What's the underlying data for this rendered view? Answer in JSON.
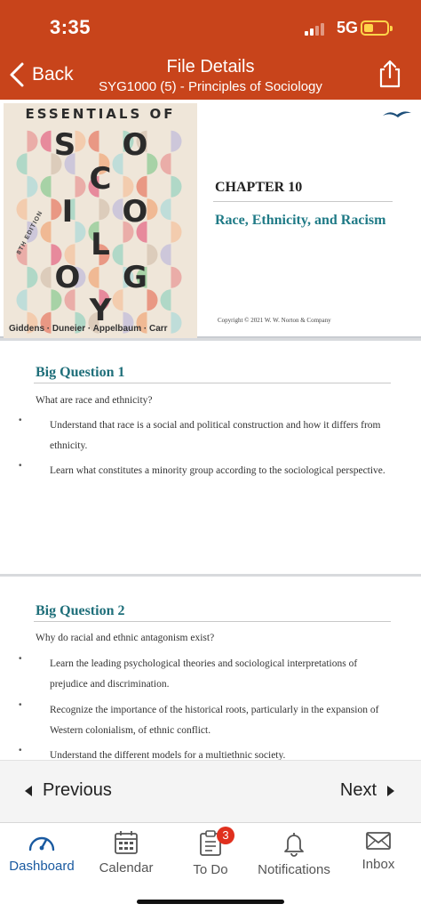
{
  "status": {
    "time": "3:35",
    "network": "5G",
    "battery_color": "#ffd54a"
  },
  "header": {
    "back_label": "Back",
    "title": "File Details",
    "subtitle": "SYG1000 (5) - Principles of Sociology",
    "background": "#c8441b",
    "share_icon": "share-icon"
  },
  "document": {
    "cover": {
      "title": "ESSENTIALS OF",
      "letters": [
        "S",
        "O",
        "C",
        "I",
        "O",
        "L",
        "O",
        "G",
        "Y"
      ],
      "edition": "8TH EDITION",
      "authors": "Giddens · Duneier · Appelbaum · Carr"
    },
    "chapter": "CHAPTER 10",
    "chapter_title": "Race, Ethnicity, and Racism",
    "copyright": "Copyright © 2021 W. W. Norton & Company",
    "big_questions": [
      {
        "title": "Big Question 1",
        "question": "What are race and ethnicity?",
        "bullets": [
          "Understand that race is a social and political construction and how it differs from ethnicity.",
          "Learn what constitutes a minority group according to the sociological perspective."
        ]
      },
      {
        "title": "Big Question 2",
        "question": "Why do racial and ethnic antagonism exist?",
        "bullets": [
          "Learn the leading psychological theories and sociological interpretations of prejudice and discrimination.",
          "Recognize the importance of the historical roots, particularly in the expansion of Western colonialism, of ethnic conflict.",
          "Understand the different models for a multiethnic society."
        ]
      }
    ]
  },
  "pager": {
    "previous_label": "Previous",
    "next_label": "Next"
  },
  "tabs": [
    {
      "label": "Dashboard",
      "icon": "dashboard-icon",
      "active": true
    },
    {
      "label": "Calendar",
      "icon": "calendar-icon",
      "active": false
    },
    {
      "label": "To Do",
      "icon": "todo-icon",
      "active": false,
      "badge": "3"
    },
    {
      "label": "Notifications",
      "icon": "bell-icon",
      "active": false
    },
    {
      "label": "Inbox",
      "icon": "inbox-icon",
      "active": false
    }
  ],
  "colors": {
    "accent": "#1a5aa0",
    "teal_heading": "#1f6f7a",
    "badge": "#e0301e"
  }
}
